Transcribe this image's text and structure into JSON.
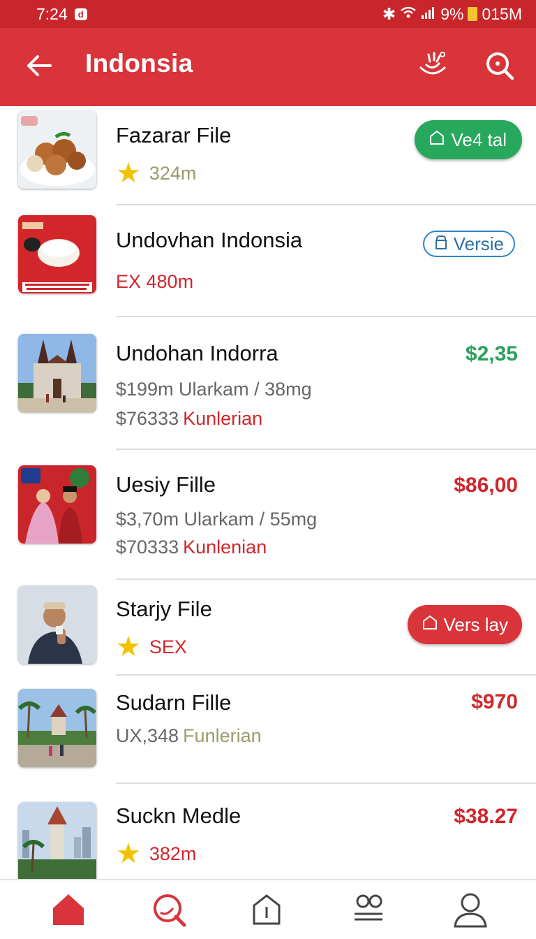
{
  "status_bar": {
    "time": "7:24",
    "chip": "d",
    "battery_pct": "9%",
    "data_rate": "015M"
  },
  "app_bar": {
    "title": "Indonsia"
  },
  "items": [
    {
      "title": "Fazarar File",
      "rating": "324m",
      "badge": "Ve4 tal"
    },
    {
      "title": "Undovhan Indonsia",
      "sub": "EX 480m",
      "badge": "Versie"
    },
    {
      "title": "Undohan Indorra",
      "line1": "$199m Ularkam / 38mg",
      "line2_value": "$76333",
      "line2_label": "Kunlerian",
      "price": "$2,35"
    },
    {
      "title": "Uesiy Fille",
      "line1": "$3,70m Ularkam / 55mg",
      "line2_value": "$70333",
      "line2_label": "Kunlenian",
      "price": "$86,00"
    },
    {
      "title": "Starjy File",
      "rating": "SEX",
      "badge": "Vers lay"
    },
    {
      "title": "Sudarn Fille",
      "line1_value": "UX,348",
      "line1_label": "Funlerian",
      "price": "$970"
    },
    {
      "title": "Suckn Medle",
      "rating": "382m",
      "price": "$38.27"
    }
  ],
  "icons": {
    "back": "arrow-left-icon",
    "brand": "brand-logo-icon",
    "search": "search-icon",
    "nav": [
      "home-icon",
      "search-icon",
      "store-icon",
      "group-icon",
      "profile-icon"
    ]
  },
  "colors": {
    "primary": "#d8343a",
    "accent_green": "#27a85c",
    "price_red": "#d0262c",
    "outline_blue": "#2d87c8"
  }
}
